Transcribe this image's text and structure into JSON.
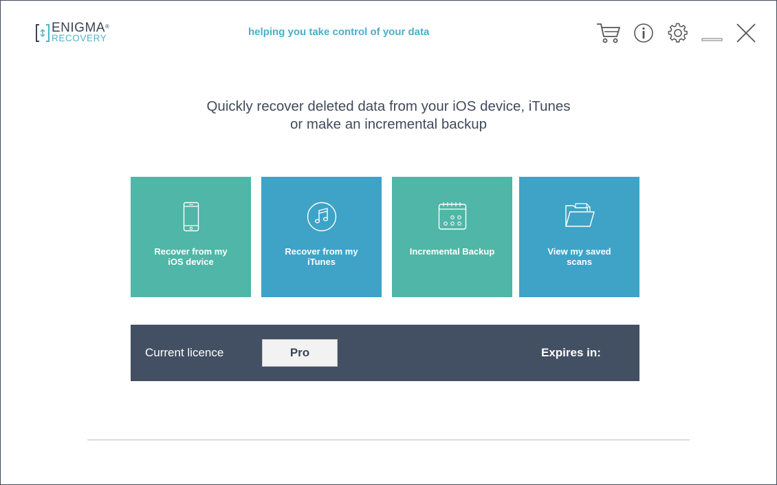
{
  "header": {
    "logo": {
      "name_top": "ENIGMA",
      "registered": "®",
      "name_bottom": "RECOVERY"
    },
    "tagline": "helping you take control of your data",
    "icons": [
      "cart-icon",
      "info-icon",
      "gear-icon",
      "minimize-icon",
      "close-icon"
    ]
  },
  "main": {
    "headline_line1": "Quickly recover deleted data from your iOS device, iTunes",
    "headline_line2": "or make an incremental backup",
    "tiles": [
      {
        "label_line1": "Recover from my",
        "label_line2": "iOS device",
        "icon": "phone-icon",
        "color": "#50b6a7"
      },
      {
        "label_line1": "Recover from my",
        "label_line2": "iTunes",
        "icon": "music-note-icon",
        "color": "#3ea3c6"
      },
      {
        "label_line1": "Incremental Backup",
        "label_line2": "",
        "icon": "calendar-icon",
        "color": "#50b6a7"
      },
      {
        "label_line1": "View my saved",
        "label_line2": "scans",
        "icon": "folder-icon",
        "color": "#3ea3c6"
      }
    ]
  },
  "licence": {
    "label": "Current licence",
    "value": "Pro",
    "expires_label": "Expires in:",
    "background": "#434f63"
  },
  "colors": {
    "accent": "#4aaec8",
    "teal": "#50b6a7",
    "blue": "#3ea3c6",
    "dark": "#434f63"
  }
}
